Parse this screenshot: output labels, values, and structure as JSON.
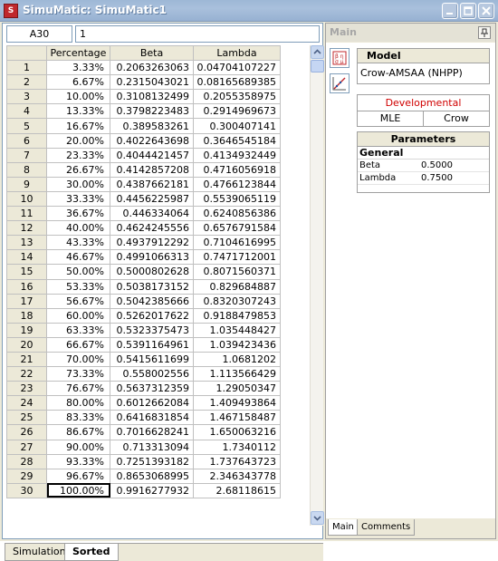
{
  "window": {
    "title": "SimuMatic: SimuMatic1"
  },
  "namebox": {
    "value": "A30"
  },
  "formula_bar": {
    "value": "1"
  },
  "grid": {
    "columns": [
      "Percentage",
      "Beta",
      "Lambda"
    ],
    "rows": [
      {
        "n": "1",
        "pct": "3.33%",
        "beta": "0.2063263063",
        "lambda": "0.04704107227"
      },
      {
        "n": "2",
        "pct": "6.67%",
        "beta": "0.2315043021",
        "lambda": "0.08165689385"
      },
      {
        "n": "3",
        "pct": "10.00%",
        "beta": "0.3108132499",
        "lambda": "0.2055358975"
      },
      {
        "n": "4",
        "pct": "13.33%",
        "beta": "0.3798223483",
        "lambda": "0.2914969673"
      },
      {
        "n": "5",
        "pct": "16.67%",
        "beta": "0.389583261",
        "lambda": "0.300407141"
      },
      {
        "n": "6",
        "pct": "20.00%",
        "beta": "0.4022643698",
        "lambda": "0.3646545184"
      },
      {
        "n": "7",
        "pct": "23.33%",
        "beta": "0.4044421457",
        "lambda": "0.4134932449"
      },
      {
        "n": "8",
        "pct": "26.67%",
        "beta": "0.4142857208",
        "lambda": "0.4716056918"
      },
      {
        "n": "9",
        "pct": "30.00%",
        "beta": "0.4387662181",
        "lambda": "0.4766123844"
      },
      {
        "n": "10",
        "pct": "33.33%",
        "beta": "0.4456225987",
        "lambda": "0.5539065119"
      },
      {
        "n": "11",
        "pct": "36.67%",
        "beta": "0.446334064",
        "lambda": "0.6240856386"
      },
      {
        "n": "12",
        "pct": "40.00%",
        "beta": "0.4624245556",
        "lambda": "0.6576791584"
      },
      {
        "n": "13",
        "pct": "43.33%",
        "beta": "0.4937912292",
        "lambda": "0.7104616995"
      },
      {
        "n": "14",
        "pct": "46.67%",
        "beta": "0.4991066313",
        "lambda": "0.7471712001"
      },
      {
        "n": "15",
        "pct": "50.00%",
        "beta": "0.5000802628",
        "lambda": "0.8071560371"
      },
      {
        "n": "16",
        "pct": "53.33%",
        "beta": "0.5038173152",
        "lambda": "0.829684887"
      },
      {
        "n": "17",
        "pct": "56.67%",
        "beta": "0.5042385666",
        "lambda": "0.8320307243"
      },
      {
        "n": "18",
        "pct": "60.00%",
        "beta": "0.5262017622",
        "lambda": "0.9188479853"
      },
      {
        "n": "19",
        "pct": "63.33%",
        "beta": "0.5323375473",
        "lambda": "1.035448427"
      },
      {
        "n": "20",
        "pct": "66.67%",
        "beta": "0.5391164961",
        "lambda": "1.039423436"
      },
      {
        "n": "21",
        "pct": "70.00%",
        "beta": "0.5415611699",
        "lambda": "1.0681202"
      },
      {
        "n": "22",
        "pct": "73.33%",
        "beta": "0.558002556",
        "lambda": "1.113566429"
      },
      {
        "n": "23",
        "pct": "76.67%",
        "beta": "0.5637312359",
        "lambda": "1.29050347"
      },
      {
        "n": "24",
        "pct": "80.00%",
        "beta": "0.6012662084",
        "lambda": "1.409493864"
      },
      {
        "n": "25",
        "pct": "83.33%",
        "beta": "0.6416831854",
        "lambda": "1.467158487"
      },
      {
        "n": "26",
        "pct": "86.67%",
        "beta": "0.7016628241",
        "lambda": "1.650063216"
      },
      {
        "n": "27",
        "pct": "90.00%",
        "beta": "0.713313094",
        "lambda": "1.7340112"
      },
      {
        "n": "28",
        "pct": "93.33%",
        "beta": "0.7251393182",
        "lambda": "1.737643723"
      },
      {
        "n": "29",
        "pct": "96.67%",
        "beta": "0.8653068995",
        "lambda": "2.346343778"
      },
      {
        "n": "30",
        "pct": "100.00%",
        "beta": "0.9916277932",
        "lambda": "2.68118615"
      }
    ]
  },
  "sheet_tabs": [
    "Simulation",
    "Sorted"
  ],
  "active_sheet": "Sorted",
  "panel": {
    "title": "Main",
    "model_heading": "Model",
    "model_value": "Crow-AMSAA (NHPP)",
    "developmental": "Developmental",
    "method": "MLE",
    "method_variant": "Crow",
    "params_heading": "Parameters",
    "params_group": "General",
    "params": [
      {
        "name": "Beta",
        "value": "0.5000"
      },
      {
        "name": "Lambda",
        "value": "0.7500"
      }
    ],
    "tabs": [
      "Main",
      "Comments"
    ]
  },
  "colors": {
    "developmental_text": "#d00000",
    "title_text": "#ffffff",
    "app_icon": "#c0282d"
  },
  "icons": [
    "app-icon",
    "minimize-icon",
    "maximize-icon",
    "close-icon",
    "pin-icon",
    "calculate-icon",
    "plot-icon",
    "scroll-up-icon",
    "scroll-down-icon"
  ]
}
